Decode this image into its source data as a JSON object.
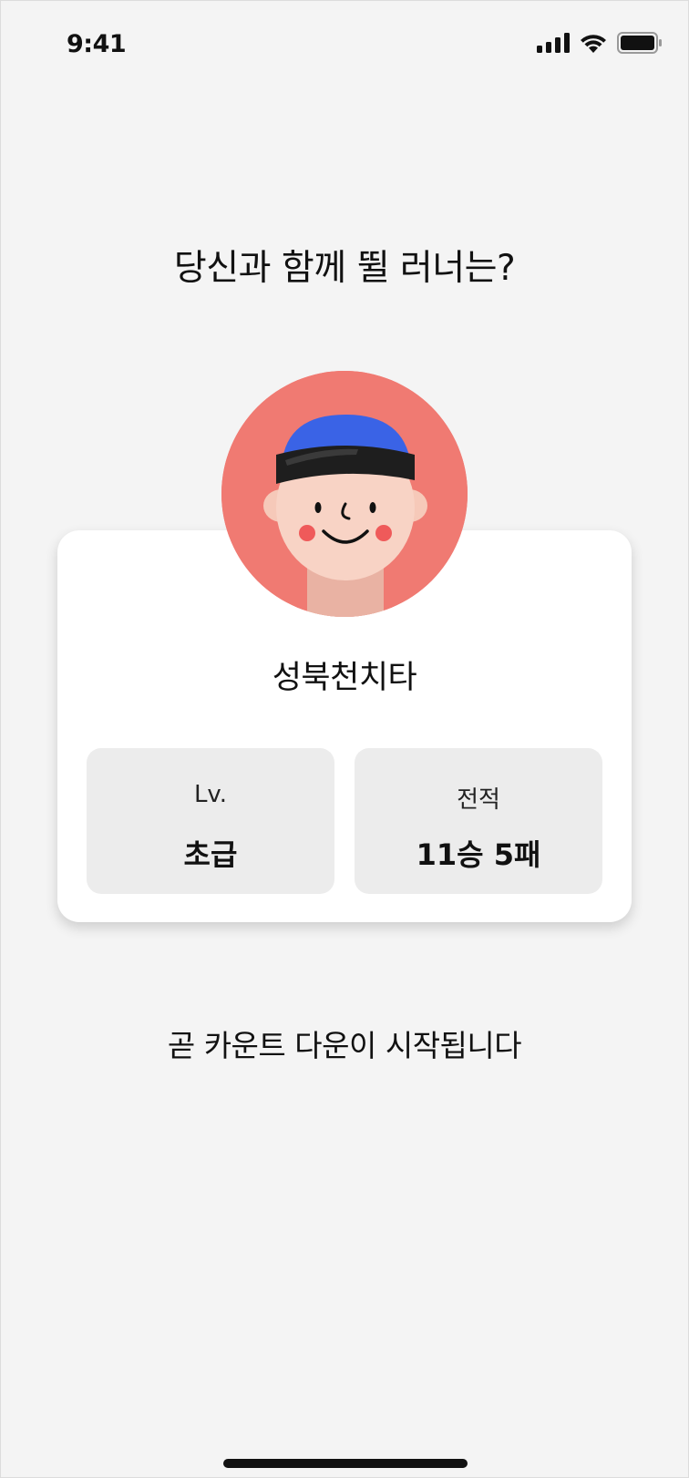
{
  "status_bar": {
    "time": "9:41",
    "icons": [
      "cellular-signal-icon",
      "wifi-icon",
      "battery-icon"
    ]
  },
  "headline": "당신과 함께 뛸 러너는?",
  "runner": {
    "name": "성북천치타",
    "avatar_icon": "runner-avatar-icon",
    "stats": {
      "level_label": "Lv.",
      "level_value": "초급",
      "record_label": "전적",
      "record_value": "11승 5패"
    }
  },
  "countdown_note": "곧 카운트 다운이 시작됩니다",
  "colors": {
    "background": "#f4f4f4",
    "card": "#ffffff",
    "stat_box": "#ececec",
    "avatar_bg": "#f07a72",
    "headband": "#1e1e1e",
    "hair": "#3a63e6",
    "skin": "#f8d2c4",
    "cheek": "#ef5a5a"
  }
}
